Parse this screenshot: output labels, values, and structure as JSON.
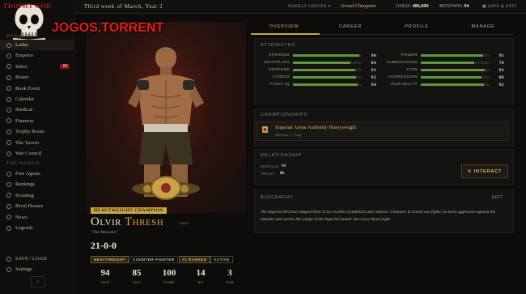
{
  "logo": {
    "top_text": "TROPHY GOD",
    "word": "JOGOS.TORRENT"
  },
  "sidebar": {
    "section_main": "DYNASTY",
    "items": [
      {
        "label": "Ludus",
        "icon": "gear-icon"
      },
      {
        "label": "Emperor",
        "icon": "crown-icon"
      },
      {
        "label": "Inbox",
        "icon": "mail-icon",
        "badge": "24"
      },
      {
        "label": "Roster",
        "icon": "users-icon"
      },
      {
        "label": "Book Event",
        "icon": "book-icon"
      },
      {
        "label": "Calendar",
        "icon": "calendar-icon"
      },
      {
        "label": "Medical",
        "icon": "medical-icon"
      },
      {
        "label": "Finances",
        "icon": "coin-icon"
      },
      {
        "label": "Trophy Room",
        "icon": "trophy-icon"
      },
      {
        "label": "The Tavern",
        "icon": "mug-icon"
      },
      {
        "label": "War Council",
        "icon": "shield-icon"
      }
    ],
    "section_world": "THE WORLD",
    "world_items": [
      {
        "label": "Free Agents",
        "icon": "user-plus-icon"
      },
      {
        "label": "Rankings",
        "icon": "list-icon"
      },
      {
        "label": "Scouting",
        "icon": "eye-icon"
      },
      {
        "label": "Rival Houses",
        "icon": "house-icon"
      },
      {
        "label": "News",
        "icon": "news-icon"
      },
      {
        "label": "Legends",
        "icon": "star-icon"
      }
    ],
    "bottom_items": [
      {
        "label": "SAVE / LOAD",
        "icon": "save-icon"
      },
      {
        "label": "Settings",
        "icon": "gear-icon"
      }
    ],
    "collapse": "‹"
  },
  "topbar": {
    "date": "Third week of March, Year 2",
    "ledger": "WEEKLY LEDGER ▾",
    "champion": "Grand Champion",
    "gold_label": "GOLD:",
    "gold_value": "486,000",
    "renown_label": "RENOWN:",
    "renown_value": "94",
    "save_exit": "SAVE & EXIT"
  },
  "fighter": {
    "title_chip": "HEAVYWEIGHT CHAMPION",
    "first_name": "Olvir",
    "last_name": "Thresh",
    "edit": "EDIT",
    "nickname": "\"The Matador\"",
    "record": "21-0-0",
    "tags": [
      "HEAVYWEIGHT",
      "COUNTER FIGHTER",
      "#1 RANKED",
      "ACTIVE"
    ],
    "stats": [
      {
        "value": "94",
        "label": "OVR"
      },
      {
        "value": "85",
        "label": "CHA"
      },
      {
        "value": "100",
        "label": "FAME"
      },
      {
        "value": "14",
        "label": "KO"
      },
      {
        "value": "3",
        "label": "SUB"
      }
    ]
  },
  "tabs": [
    "OVERVIEW",
    "CAREER",
    "PROFILE",
    "MANAGE"
  ],
  "attributes": {
    "title": "ATTRIBUTES",
    "left": [
      {
        "name": "STRIKING",
        "value": 96
      },
      {
        "name": "GRAPPLING",
        "value": 84
      },
      {
        "name": "DEFENSE",
        "value": 91
      },
      {
        "name": "CARDIO",
        "value": 92
      },
      {
        "name": "FIGHT IQ",
        "value": 94
      }
    ],
    "right": [
      {
        "name": "POWER",
        "value": 91
      },
      {
        "name": "SUBMISSIONS",
        "value": 78
      },
      {
        "name": "CHIN",
        "value": 93
      },
      {
        "name": "AGGRESSION",
        "value": 88
      },
      {
        "name": "DURABILITY",
        "value": 92
      }
    ]
  },
  "championships": {
    "title": "CHAMPIONSHIPS",
    "name": "Imperial Arena Authority Heavyweight",
    "sub": "Won Year 1 · 3 def."
  },
  "relationship": {
    "title": "RELATIONSHIP",
    "morale_label": "MORALE",
    "morale_value": "91",
    "trust_label": "TRUST",
    "trust_value": "86",
    "interact": "INTERACT"
  },
  "biography": {
    "title": "BIOGRAPHY",
    "edit": "EDIT",
    "text": "The Imperial Province shaped Olvir in its crucible of ambition and violence. Unbeaten in twenty-one fights, he turns aggression against the attacker and carries the weight of the Imperial banner into every blood night."
  },
  "colors": {
    "accent": "#c9a447",
    "bar": "#5a9a3c",
    "badge": "#8e1515",
    "logo_red": "#e21b1b"
  }
}
